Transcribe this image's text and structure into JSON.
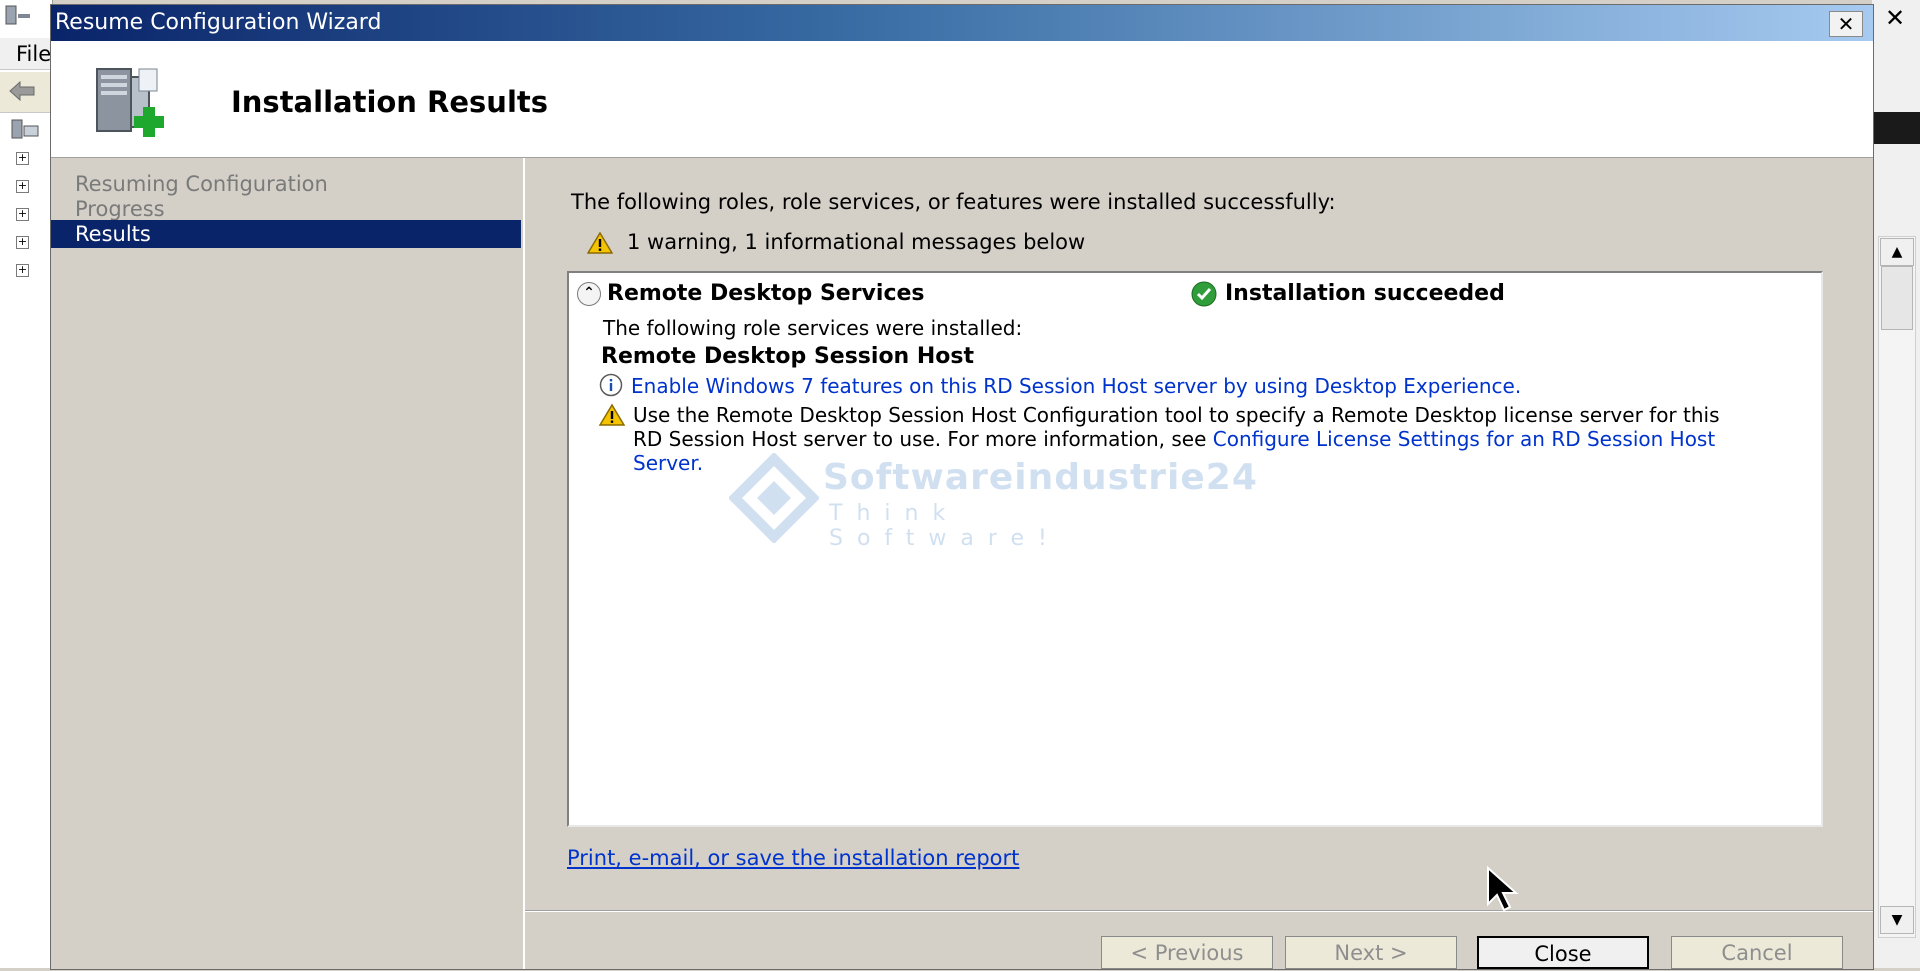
{
  "background_window": {
    "menu_label": "File",
    "close_glyph": "✕",
    "expanders": [
      "+",
      "+",
      "+",
      "+",
      "+"
    ]
  },
  "wizard": {
    "title": "Resume Configuration Wizard",
    "close_glyph": "✕",
    "header_title": "Installation Results",
    "header_icon": "server-add-icon"
  },
  "nav": {
    "items": [
      {
        "label": "Resuming Configuration",
        "state": "disabled"
      },
      {
        "label": "Progress",
        "state": "disabled"
      },
      {
        "label": "Results",
        "state": "selected"
      }
    ]
  },
  "content": {
    "intro": "The following roles, role services, or features were installed successfully:",
    "summary": "1 warning, 1 informational messages below",
    "results": {
      "role_name": "Remote Desktop Services",
      "status": "Installation succeeded",
      "installed_label": "The following role services were installed:",
      "role_service": "Remote Desktop Session Host",
      "info_link": "Enable Windows 7 features on this RD Session Host server by using Desktop Experience.",
      "warning_text": "Use the Remote Desktop Session Host Configuration tool to specify a Remote Desktop license server for this RD Session Host server to use. For more information, see",
      "warning_link": "Configure License Settings for an RD Session Host Server."
    },
    "report_link": "Print, e-mail, or save the installation report"
  },
  "watermark": {
    "brand": "Softwareindustrie24",
    "tagline": "Think Software!"
  },
  "buttons": {
    "previous": "< Previous",
    "next": "Next >",
    "close": "Close",
    "cancel": "Cancel"
  },
  "colors": {
    "title_gradient_start": "#0a246a",
    "selection": "#0a246a",
    "link": "#0033cc",
    "disabled_text": "#7a7a7a",
    "dialog_face": "#d4d0c8"
  }
}
